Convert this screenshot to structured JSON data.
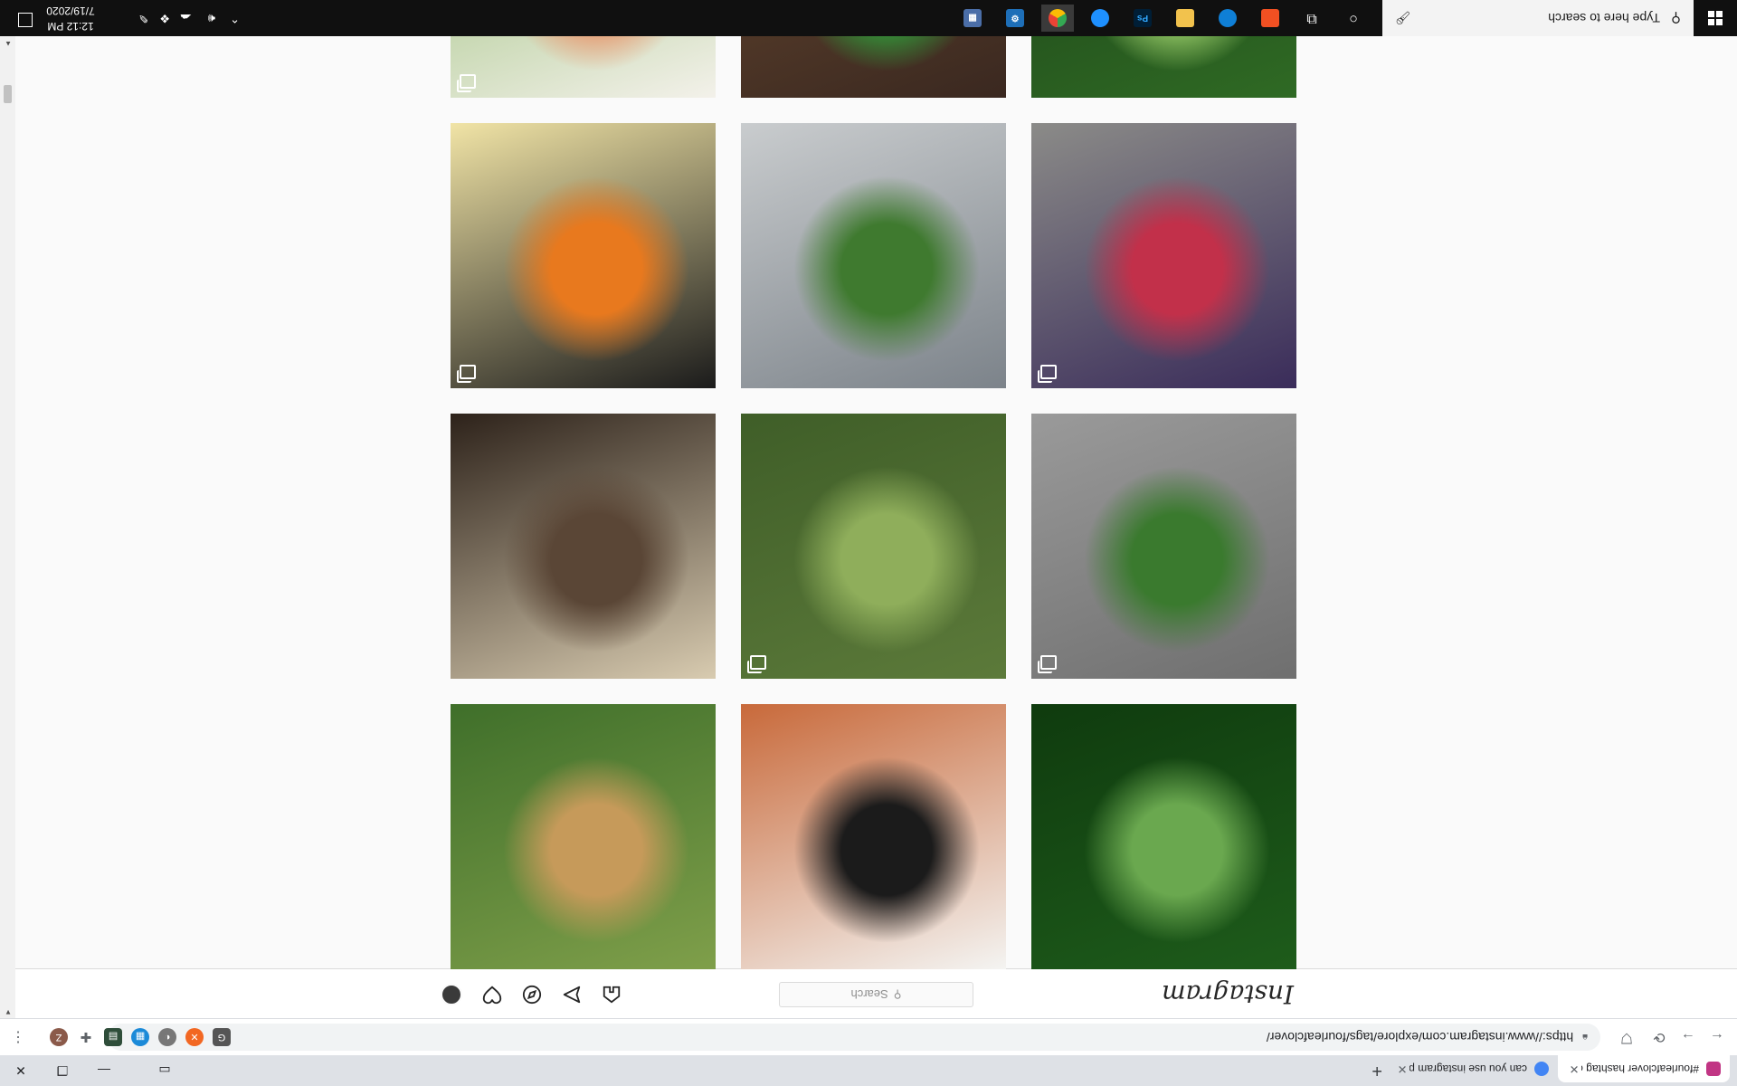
{
  "browser": {
    "tabs": [
      {
        "title": "#fourleafclover hashtag on Insta",
        "favicon_color": "#c13584",
        "active": true
      },
      {
        "title": "can you use instagram photos fo",
        "favicon_color": "#4285f4",
        "active": false
      }
    ],
    "new_tab_label": "+",
    "address": "https://www.instagram.com/explore/tags/fourleafclover/",
    "extensions": [
      "G",
      "●",
      "◐",
      "▦",
      "✚",
      "Z"
    ]
  },
  "instagram": {
    "logo": "Instagram",
    "search_placeholder": "Search",
    "nav": [
      "home-icon",
      "direct-icon",
      "explore-icon",
      "activity-icon",
      "profile-avatar"
    ]
  },
  "posts": [
    {
      "id": "p1",
      "colors": [
        "#1e5c1b",
        "#6aa84f",
        "#0f3b0e"
      ],
      "multi": false
    },
    {
      "id": "p2",
      "colors": [
        "#f4f4f2",
        "#1b1b1b",
        "#c8693a"
      ],
      "multi": false
    },
    {
      "id": "p3",
      "colors": [
        "#7f9f4a",
        "#c69a5a",
        "#3f6f2a"
      ],
      "multi": false
    },
    {
      "id": "p4",
      "colors": [
        "#6f6f6f",
        "#3a7a2e",
        "#9a9a9a"
      ],
      "multi": true
    },
    {
      "id": "p5",
      "colors": [
        "#5c7a3a",
        "#8fae5b",
        "#3f5e28"
      ],
      "multi": true
    },
    {
      "id": "p6",
      "colors": [
        "#d8cbb0",
        "#5a4636",
        "#2d221a"
      ],
      "multi": false
    },
    {
      "id": "p7",
      "colors": [
        "#3a2c5a",
        "#c2304a",
        "#8b8b88"
      ],
      "multi": true
    },
    {
      "id": "p8",
      "colors": [
        "#7c838a",
        "#3f7a2f",
        "#c9ccce"
      ],
      "multi": false
    },
    {
      "id": "p9",
      "colors": [
        "#1b1b1b",
        "#e8791e",
        "#f1e4a6"
      ],
      "multi": true
    },
    {
      "id": "p10",
      "colors": [
        "#2f6a24",
        "#9bcf6a",
        "#1b3f17"
      ],
      "multi": false
    },
    {
      "id": "p11",
      "colors": [
        "#3a2820",
        "#2f9e3a",
        "#6a4a30"
      ],
      "multi": false
    },
    {
      "id": "p12",
      "colors": [
        "#f3f1ea",
        "#e9946a",
        "#8fb86a"
      ],
      "multi": true
    }
  ],
  "taskbar": {
    "search_placeholder": "Type here to search",
    "apps": [
      "cortana-icon",
      "task-view-icon",
      "store-icon",
      "edge-icon",
      "file-explorer-icon",
      "photoshop-icon",
      "onedrive-icon",
      "chrome-icon",
      "settings-icon",
      "calendar-icon"
    ],
    "app_colors": {
      "store": "#f25022",
      "edge": "#0f7fd6",
      "explorer": "#f2c24d",
      "photoshop": "#001e36",
      "onedrive": "#1e90ff",
      "chrome": "#fbbc05",
      "settings": "#1e6fb8",
      "calendar": "#4b6ea8"
    },
    "photoshop_label": "Ps",
    "time": "12:12 PM",
    "date": "7/19/2020"
  }
}
